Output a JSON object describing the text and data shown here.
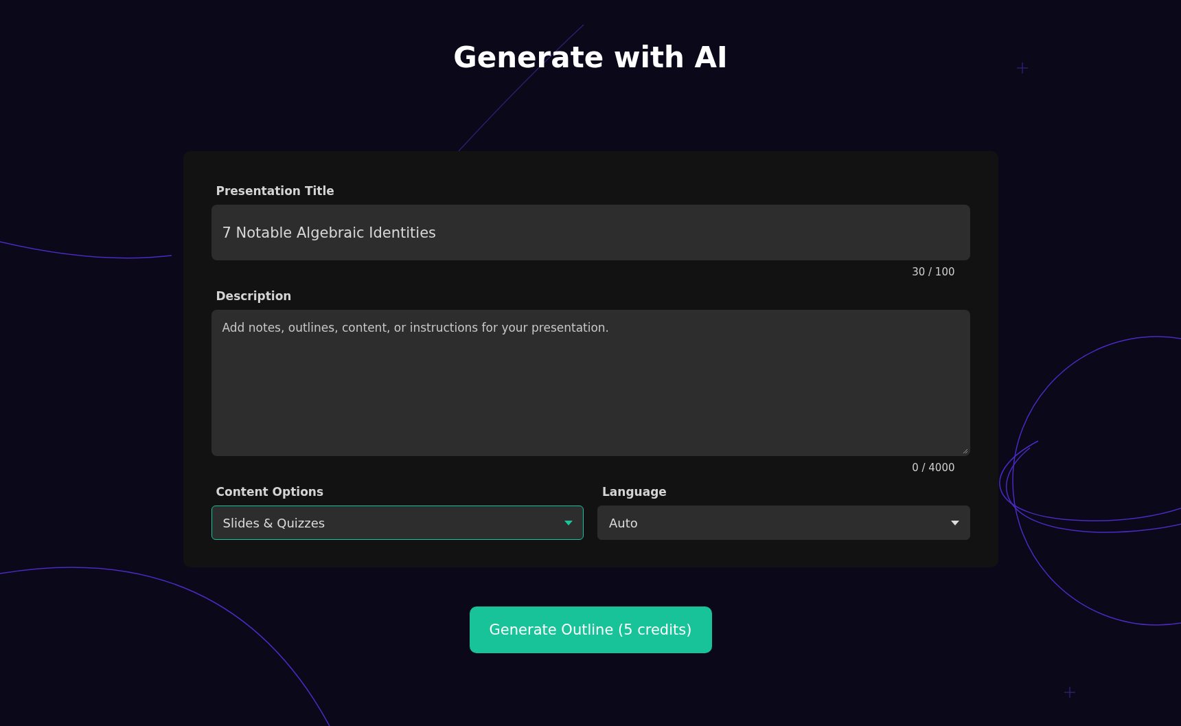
{
  "heading": "Generate with AI",
  "form": {
    "title_field": {
      "label": "Presentation Title",
      "value": "7 Notable Algebraic Identities",
      "counter": "30 / 100"
    },
    "description_field": {
      "label": "Description",
      "placeholder": "Add notes, outlines, content, or instructions for your presentation.",
      "counter": "0 / 4000"
    },
    "selects": [
      {
        "label": "Content Options",
        "value": "Slides & Quizzes",
        "focused": true
      },
      {
        "label": "Language",
        "value": "Auto",
        "focused": false
      }
    ]
  },
  "button": {
    "label": "Generate Outline (5 credits)"
  }
}
